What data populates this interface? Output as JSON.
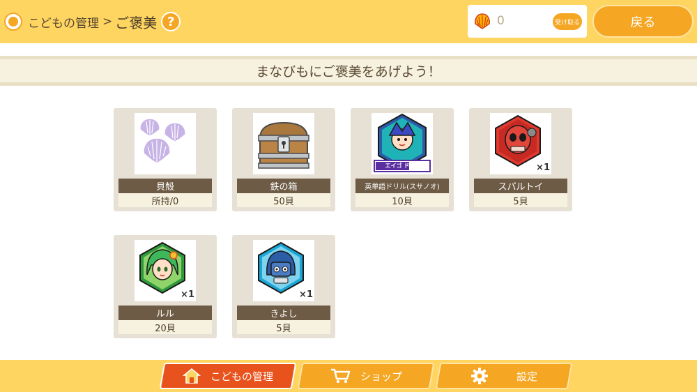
{
  "header": {
    "breadcrumb_parent": "こどもの管理",
    "breadcrumb_separator": ">",
    "breadcrumb_current": "ご褒美",
    "help_label": "?",
    "shell_count": "0",
    "receive_label": "受け取る",
    "back_label": "戻る"
  },
  "banner": {
    "text": "まなびもにご褒美をあげよう！"
  },
  "rewards": [
    {
      "name": "貝殻",
      "sub": "所持/0",
      "icon": "seashell-icon"
    },
    {
      "name": "鉄の箱",
      "sub": "50貝",
      "icon": "treasure-chest-icon"
    },
    {
      "name": "英単語ドリル(スサノオ)",
      "sub": "10貝",
      "icon": "susanoo-drill-badge-icon",
      "image_text": "エイゴ ドリル"
    },
    {
      "name": "スパルトイ",
      "sub": "5貝",
      "count": "×1",
      "icon": "spartoi-badge-icon"
    },
    {
      "name": "ルル",
      "sub": "20貝",
      "count": "×1",
      "icon": "lulu-badge-icon"
    },
    {
      "name": "きよし",
      "sub": "5貝",
      "count": "×1",
      "icon": "kiyoshi-badge-icon"
    }
  ],
  "nav": [
    {
      "label": "こどもの管理",
      "icon": "home-icon",
      "active": true
    },
    {
      "label": "ショップ",
      "icon": "shopping-cart-icon",
      "active": false
    },
    {
      "label": "設定",
      "icon": "gear-icon",
      "active": false
    }
  ],
  "colors": {
    "header_bg": "#ffd562",
    "accent_orange": "#f5a623",
    "active_tab": "#e8531d",
    "card_bg": "#e6e1d4",
    "label_brown": "#6e5b45"
  }
}
